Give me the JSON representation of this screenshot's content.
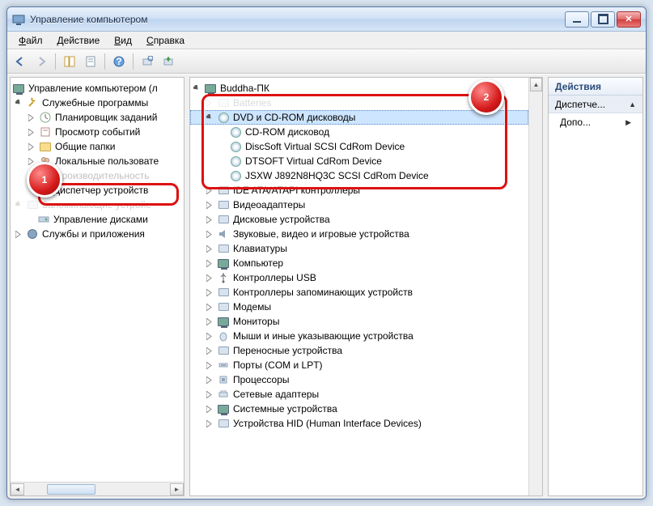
{
  "title": "Управление компьютером",
  "menu": {
    "file": "Файл",
    "action": "Действие",
    "view": "Вид",
    "help": "Справка"
  },
  "left_tree": {
    "root": "Управление компьютером (л",
    "sys_tools": "Служебные программы",
    "task_sched": "Планировщик заданий",
    "event_view": "Просмотр событий",
    "shared": "Общие папки",
    "local_users": "Локальные пользовате",
    "perf": "Производительность",
    "devmgr": "Диспетчер устройств",
    "storage": "Запоминающие устройс",
    "diskmgmt": "Управление дисками",
    "services": "Службы и приложения"
  },
  "device_tree": {
    "root": "Buddha-ПК",
    "cat_hidden_top": "Batteries",
    "dvd": "DVD и CD-ROM дисководы",
    "dvd_items": [
      "CD-ROM дисковод",
      "DiscSoft Virtual SCSI CdRom Device",
      "DTSOFT Virtual CdRom Device",
      "JSXW J892N8HQ3C SCSI CdRom Device"
    ],
    "ide": "IDE ATA/ATAPI контроллеры",
    "video": "Видеоадаптеры",
    "disk": "Дисковые устройства",
    "sound": "Звуковые, видео и игровые устройства",
    "keyboard": "Клавиатуры",
    "computer": "Компьютер",
    "usb": "Контроллеры USB",
    "storage_ctrl": "Контроллеры запоминающих устройств",
    "modems": "Модемы",
    "monitors": "Мониторы",
    "mice": "Мыши и иные указывающие устройства",
    "portable": "Переносные устройства",
    "ports": "Порты (COM и LPT)",
    "cpu": "Процессоры",
    "net": "Сетевые адаптеры",
    "sysdev": "Системные устройства",
    "hid": "Устройства HID (Human Interface Devices)"
  },
  "actions": {
    "header": "Действия",
    "section": "Диспетче...",
    "more": "Допо..."
  },
  "badges": {
    "one": "1",
    "two": "2"
  }
}
